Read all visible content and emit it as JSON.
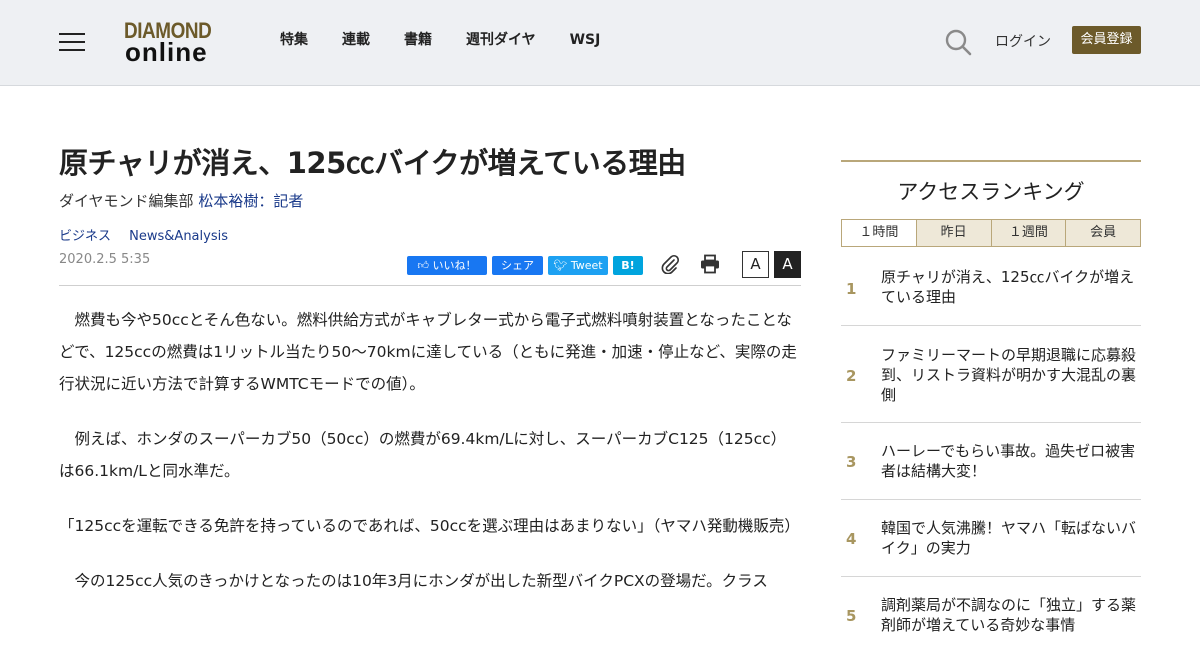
{
  "header": {
    "logo_line1": "DIAMOND",
    "logo_line2": "online",
    "nav": [
      "特集",
      "連載",
      "書籍",
      "週刊ダイヤ",
      "WSJ"
    ],
    "login_label": "ログイン",
    "register_label": "会員登録"
  },
  "article": {
    "title": "原チャリが消え、125㏄バイクが増えている理由",
    "byline_prefix": "ダイヤモンド編集部",
    "author": "松本裕樹：記者",
    "tags": [
      "ビジネス",
      "News&Analysis"
    ],
    "date": "2020.2.5 5:35",
    "share": {
      "facebook": "いいね！",
      "share": "シェア",
      "tweet": "Tweet",
      "hatena": "B!"
    },
    "font_small": "A",
    "font_large": "A",
    "paragraphs": [
      "　燃費も今や50ccとそん色ない。燃料供給方式がキャブレター式から電子式燃料噴射装置となったことなどで、125ccの燃費は1リットル当たり50～70kmに達している（ともに発進・加速・停止など、実際の走行状況に近い方法で計算するWMTCモードでの値）。",
      "　例えば、ホンダのスーパーカブ50（50cc）の燃費が69.4km/Lに対し、スーパーカブC125（125cc）は66.1km/Lと同水準だ。",
      "「125ccを運転できる免許を持っているのであれば、50ccを選ぶ理由はあまりない」（ヤマハ発動機販売）",
      "　今の125cc人気のきっかけとなったのは10年3月にホンダが出した新型バイクPCXの登場だ。クラス"
    ]
  },
  "sidebar": {
    "title": "アクセスランキング",
    "tabs": [
      "１時間",
      "昨日",
      "１週間",
      "会員"
    ],
    "ranking": [
      {
        "num": "1",
        "text": "原チャリが消え、125㏄バイクが増えている理由"
      },
      {
        "num": "2",
        "text": "ファミリーマートの早期退職に応募殺到、リストラ資料が明かす大混乱の裏側"
      },
      {
        "num": "3",
        "text": "ハーレーでもらい事故。過失ゼロ被害者は結構大変！"
      },
      {
        "num": "4",
        "text": "韓国で人気沸騰！ヤマハ「転ばないバイク」の実力"
      },
      {
        "num": "5",
        "text": "調剤薬局が不調なのに「独立」する薬剤師が増えている奇妙な事情"
      }
    ]
  },
  "colors": {
    "brand_gold": "#6c5a2a",
    "header_bg": "#eef0f3",
    "link_blue": "#1a3a8a",
    "rank_accent": "#b9a77a"
  }
}
